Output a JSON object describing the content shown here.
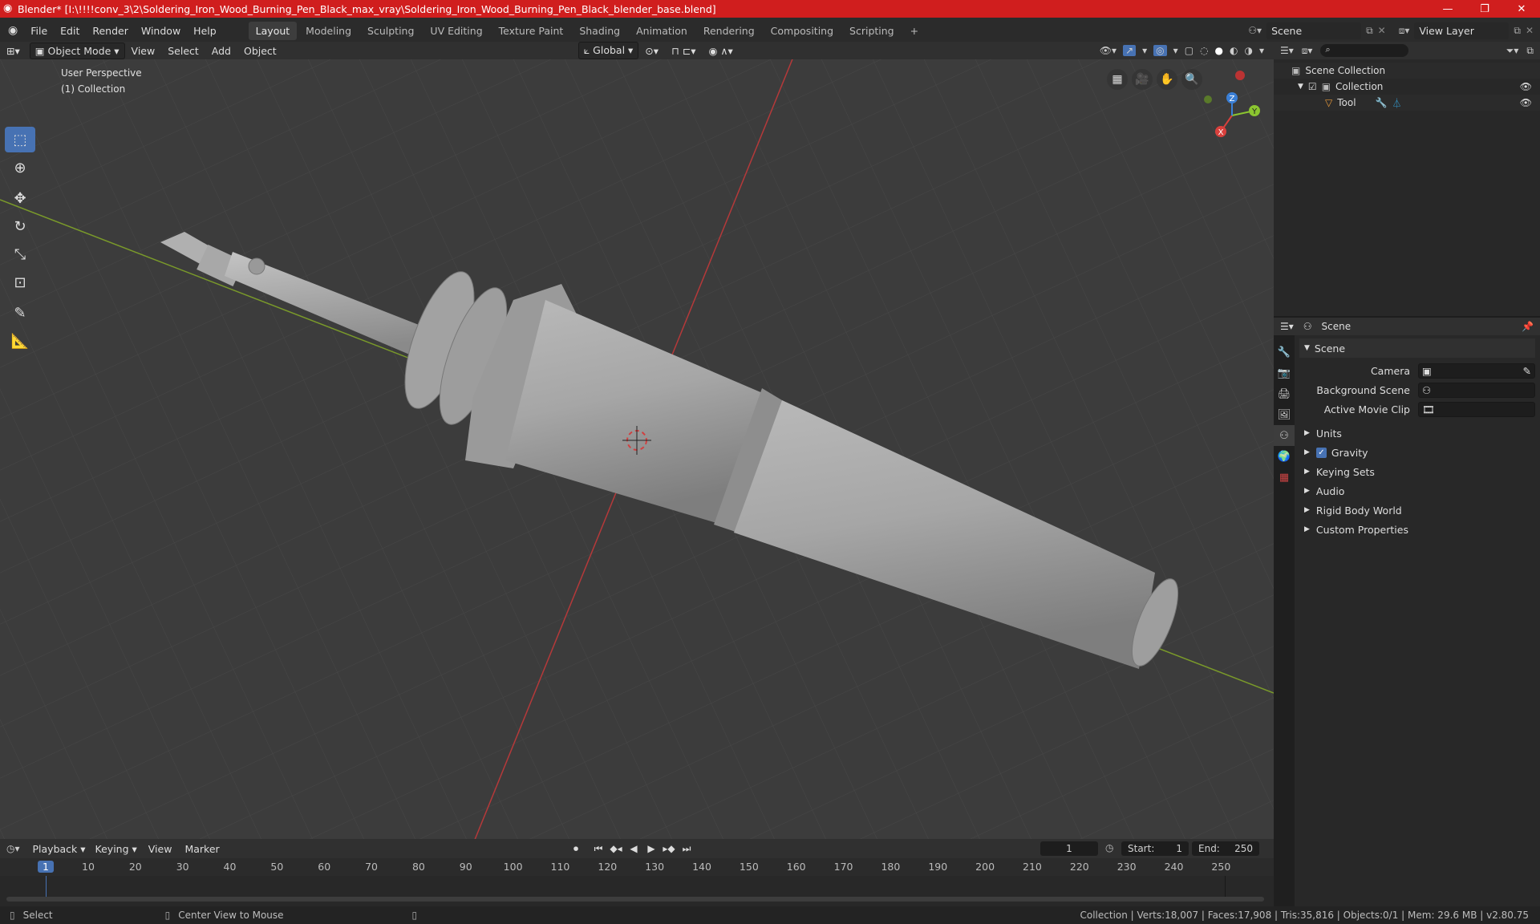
{
  "window": {
    "title": "Blender* [I:\\!!!!conv_3\\2\\Soldering_Iron_Wood_Burning_Pen_Black_max_vray\\Soldering_Iron_Wood_Burning_Pen_Black_blender_base.blend]",
    "minimize": "—",
    "maximize": "❐",
    "close": "✕"
  },
  "menubar": {
    "items": [
      "File",
      "Edit",
      "Render",
      "Window",
      "Help"
    ],
    "workspaces": [
      "Layout",
      "Modeling",
      "Sculpting",
      "UV Editing",
      "Texture Paint",
      "Shading",
      "Animation",
      "Rendering",
      "Compositing",
      "Scripting"
    ],
    "active_workspace": "Layout",
    "add_workspace": "+",
    "scene": "Scene",
    "view_layer": "View Layer"
  },
  "viewport_header": {
    "mode": "Object Mode",
    "menus": [
      "View",
      "Select",
      "Add",
      "Object"
    ],
    "orientation": "Global"
  },
  "viewport": {
    "perspective": "User Perspective",
    "collection": "(1) Collection",
    "gizmo": {
      "x": "X",
      "y": "Y",
      "z": "Z"
    }
  },
  "outliner": {
    "root": "Scene Collection",
    "collection": "Collection",
    "object": "Tool"
  },
  "properties": {
    "context": "Scene",
    "panel_title": "Scene",
    "camera_label": "Camera",
    "background_scene_label": "Background Scene",
    "active_movie_clip_label": "Active Movie Clip",
    "sections": [
      "Units",
      "Gravity",
      "Keying Sets",
      "Audio",
      "Rigid Body World",
      "Custom Properties"
    ],
    "gravity_checked": true
  },
  "timeline": {
    "menus": [
      "Playback",
      "Keying",
      "View",
      "Marker"
    ],
    "current_frame": "1",
    "start_label": "Start:",
    "start": "1",
    "end_label": "End:",
    "end": "250",
    "ruler": [
      "1",
      "10",
      "20",
      "30",
      "40",
      "50",
      "60",
      "70",
      "80",
      "90",
      "100",
      "110",
      "120",
      "130",
      "140",
      "150",
      "160",
      "170",
      "180",
      "190",
      "200",
      "210",
      "220",
      "230",
      "240",
      "250"
    ]
  },
  "statusbar": {
    "select": "Select",
    "center_view": "Center View to Mouse",
    "stats": "Collection | Verts:18,007 | Faces:17,908 | Tris:35,816 | Objects:0/1 | Mem: 29.6 MB | v2.80.75"
  },
  "colors": {
    "title_bg": "#d01e1e",
    "accent": "#4772b3",
    "x_axis": "#d8403c",
    "y_axis": "#8bc530",
    "z_axis": "#3a7fd6"
  }
}
